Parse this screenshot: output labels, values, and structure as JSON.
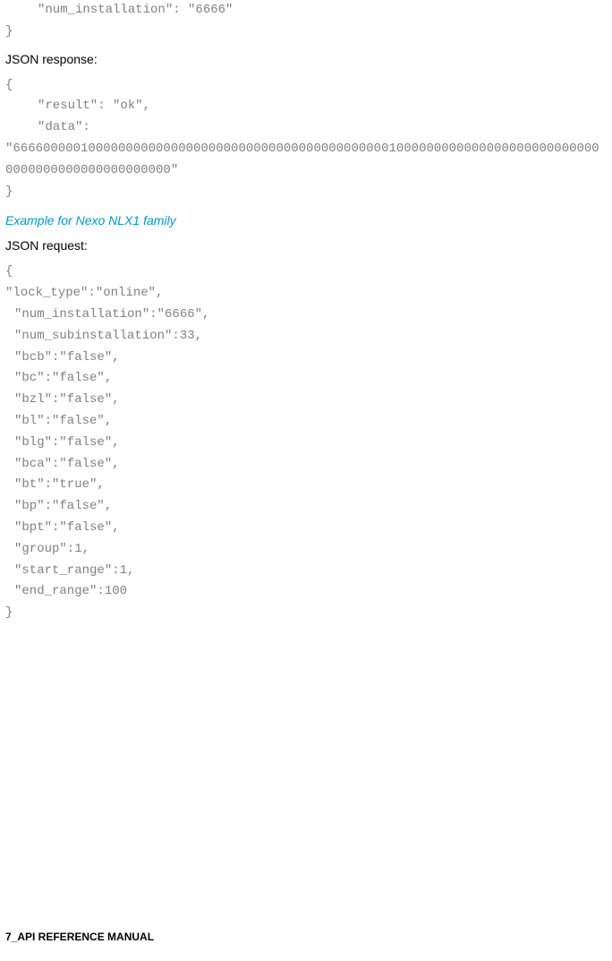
{
  "top_code": {
    "line1": "\"num_installation\": \"6666\"",
    "line2": "}"
  },
  "response_label": "JSON response:",
  "response_code": {
    "open": "{",
    "line1": "\"result\": \"ok\",",
    "line2_key": "\"data\":",
    "line2_value": "\"6666000001000000000000000000000000000000000000000010000000000000000000000000000000000000000000000000\"",
    "close": "}"
  },
  "heading": "Example for Nexo NLX1 family",
  "request_label": "JSON request:",
  "request_code": {
    "open": "{",
    "line1": "\"lock_type\":\"online\",",
    "line2": "\"num_installation\":\"6666\",",
    "line3": "\"num_subinstallation\":33,",
    "line4": "\"bcb\":\"false\",",
    "line5": "\"bc\":\"false\",",
    "line6": "\"bzl\":\"false\",",
    "line7": "\"bl\":\"false\",",
    "line8": "\"blg\":\"false\",",
    "line9": "\"bca\":\"false\",",
    "line10": "\"bt\":\"true\",",
    "line11": "\"bp\":\"false\",",
    "line12": "\"bpt\":\"false\",",
    "line13": "\"group\":1,",
    "line14": "\"start_range\":1,",
    "line15": "\"end_range\":100",
    "close": "}"
  },
  "footer": "7_API REFERENCE MANUAL"
}
